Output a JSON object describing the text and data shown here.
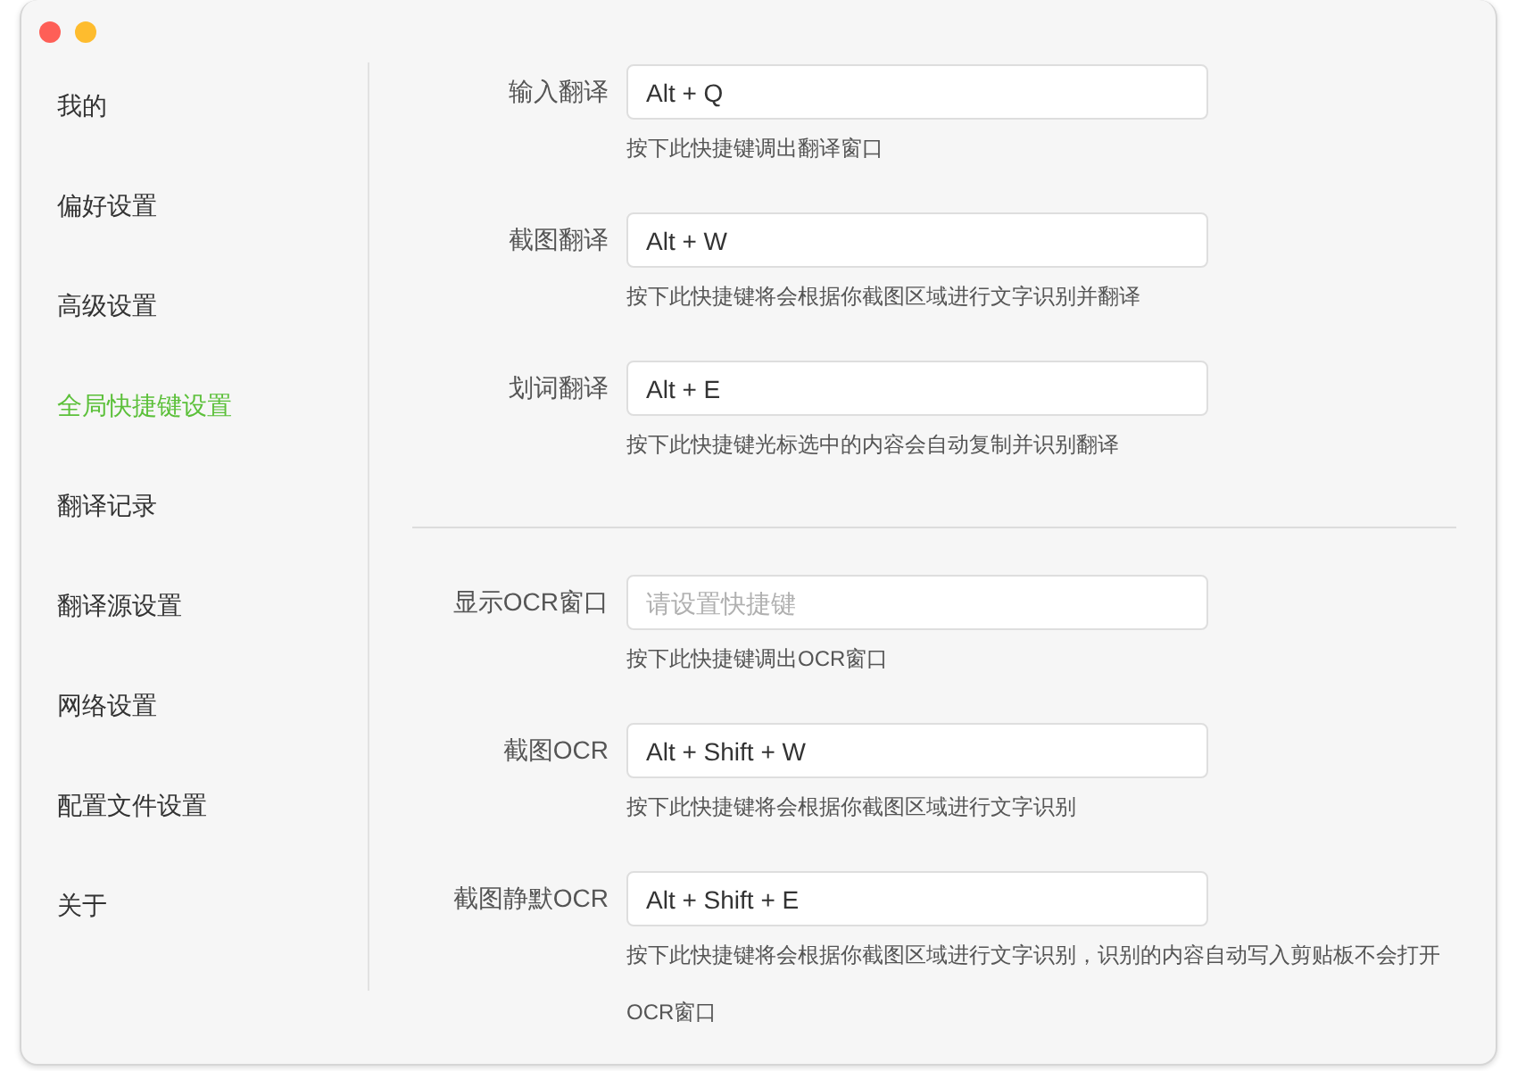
{
  "sidebar": {
    "items": [
      {
        "label": "我的",
        "selected": false
      },
      {
        "label": "偏好设置",
        "selected": false
      },
      {
        "label": "高级设置",
        "selected": false
      },
      {
        "label": "全局快捷键设置",
        "selected": true
      },
      {
        "label": "翻译记录",
        "selected": false
      },
      {
        "label": "翻译源设置",
        "selected": false
      },
      {
        "label": "网络设置",
        "selected": false
      },
      {
        "label": "配置文件设置",
        "selected": false
      },
      {
        "label": "关于",
        "selected": false
      }
    ]
  },
  "groups": [
    {
      "shortcuts": [
        {
          "label": "输入翻译",
          "value": "Alt + Q",
          "hint": "按下此快捷键调出翻译窗口"
        },
        {
          "label": "截图翻译",
          "value": "Alt + W",
          "hint": "按下此快捷键将会根据你截图区域进行文字识别并翻译"
        },
        {
          "label": "划词翻译",
          "value": "Alt + E",
          "hint": "按下此快捷键光标选中的内容会自动复制并识别翻译"
        }
      ]
    },
    {
      "shortcuts": [
        {
          "label": "显示OCR窗口",
          "placeholder": "请设置快捷键",
          "hint": "按下此快捷键调出OCR窗口"
        },
        {
          "label": "截图OCR",
          "value": "Alt + Shift + W",
          "hint": "按下此快捷键将会根据你截图区域进行文字识别"
        },
        {
          "label": "截图静默OCR",
          "value": "Alt + Shift + E",
          "hint": "按下此快捷键将会根据你截图区域进行文字识别，识别的内容自动写入剪贴板不会打开OCR窗口"
        }
      ]
    }
  ]
}
